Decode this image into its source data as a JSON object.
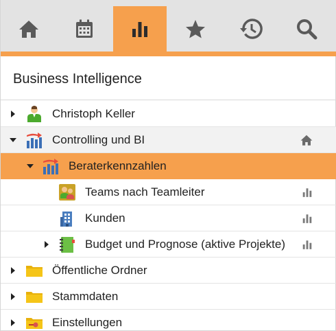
{
  "tabs": [
    {
      "icon": "home-icon",
      "label": ""
    },
    {
      "icon": "calendar-icon",
      "label": ""
    },
    {
      "icon": "bar-chart-icon",
      "label": ""
    },
    {
      "icon": "star-icon",
      "label": ""
    },
    {
      "icon": "history-icon",
      "label": ""
    },
    {
      "icon": "search-icon",
      "label": ""
    }
  ],
  "colors": {
    "accent": "#f6a04d",
    "tabbar_bg": "#e3e3e3",
    "icon_gray": "#5a5a5a",
    "folder_yellow": "#f5c518"
  },
  "heading": "Business Intelligence",
  "tree": [
    {
      "label": "Christoph Keller",
      "icon": "person-icon",
      "state": "collapsed",
      "action": ""
    },
    {
      "label": "Controlling und BI",
      "icon": "bi-chart-icon",
      "state": "expanded",
      "action": "home-icon"
    },
    {
      "label": "Beraterkennzahlen",
      "icon": "bi-chart-icon",
      "state": "expanded",
      "action": ""
    },
    {
      "label": "Teams nach Teamleiter",
      "icon": "team-icon",
      "state": "leaf",
      "action": "bar-chart-icon"
    },
    {
      "label": "Kunden",
      "icon": "building-icon",
      "state": "leaf",
      "action": "bar-chart-icon"
    },
    {
      "label": "Budget und Prognose (aktive Projekte)",
      "icon": "notebook-icon",
      "state": "collapsed",
      "action": "bar-chart-icon"
    },
    {
      "label": "Öffentliche Ordner",
      "icon": "folder-icon",
      "state": "collapsed",
      "action": ""
    },
    {
      "label": "Stammdaten",
      "icon": "folder-icon",
      "state": "collapsed",
      "action": ""
    },
    {
      "label": "Einstellungen",
      "icon": "settings-folder-icon",
      "state": "collapsed",
      "action": ""
    }
  ]
}
